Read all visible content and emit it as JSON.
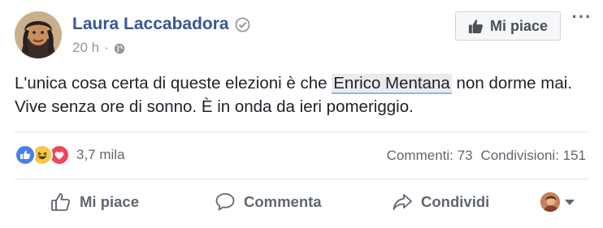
{
  "post": {
    "author": "Laura Laccabadora",
    "time": "20 h",
    "separator": "·",
    "text_before": "L'unica cosa certa di queste elezioni è che ",
    "mention": "Enrico Mentana",
    "text_after": " non dorme mai. Vive senza ore di sonno. È in onda da ieri pomeriggio."
  },
  "header": {
    "like_page_label": "Mi piace",
    "more_label": "···"
  },
  "stats": {
    "reactions_count": "3,7 mila",
    "comments": "Commenti: 73",
    "shares": "Condivisioni: 151",
    "reaction_types": [
      "like-icon",
      "haha-icon",
      "love-icon"
    ]
  },
  "actions": {
    "like": "Mi piace",
    "comment": "Commenta",
    "share": "Condividi"
  },
  "colors": {
    "author": "#365899",
    "secondary_text": "#606770",
    "like_reaction": "#4c7fe6",
    "haha_reaction": "#f7c843",
    "love_reaction": "#f0465a"
  }
}
